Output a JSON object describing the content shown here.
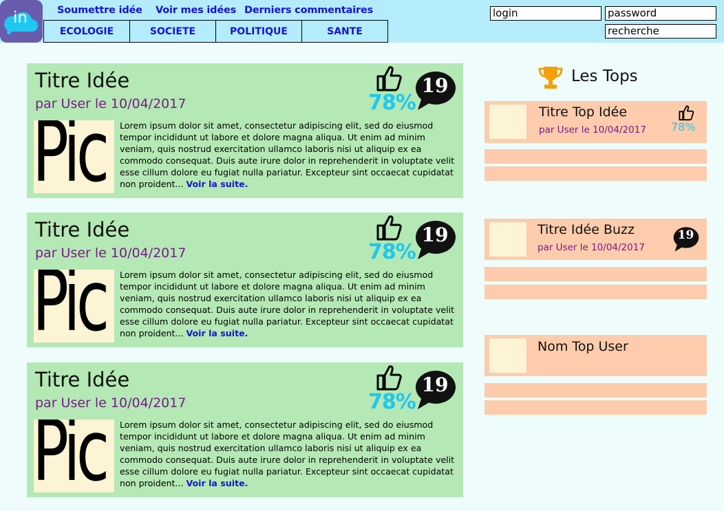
{
  "header": {
    "logo_text": "in",
    "nav": {
      "submit": "Soumettre idée",
      "my_ideas": "Voir mes idées",
      "latest_comments": "Derniers commentaires"
    },
    "categories": [
      "ECOLOGIE",
      "SOCIETE",
      "POLITIQUE",
      "SANTE"
    ],
    "login_placeholder": "login",
    "password_placeholder": "password",
    "search_placeholder": "recherche"
  },
  "ideas": [
    {
      "title": "Titre Idée",
      "author": "par User le 10/04/2017",
      "percent": "78%",
      "comments": "19",
      "pic": "Pic",
      "body": "Lorem ipsum dolor sit amet, consectetur adipiscing elit, sed do eiusmod tempor incididunt ut labore et dolore magna aliqua. Ut enim ad minim veniam, quis nostrud exercitation ullamco laboris nisi ut aliquip ex ea commodo consequat. Duis aute irure dolor in reprehenderit in voluptate velit esse cillum dolore eu fugiat nulla pariatur. Excepteur sint occaecat cupidatat non proident...",
      "more": "Voir la suite."
    },
    {
      "title": "Titre Idée",
      "author": "par User le 10/04/2017",
      "percent": "78%",
      "comments": "19",
      "pic": "Pic",
      "body": "Lorem ipsum dolor sit amet, consectetur adipiscing elit, sed do eiusmod tempor incididunt ut labore et dolore magna aliqua. Ut enim ad minim veniam, quis nostrud exercitation ullamco laboris nisi ut aliquip ex ea commodo consequat. Duis aute irure dolor in reprehenderit in voluptate velit esse cillum dolore eu fugiat nulla pariatur. Excepteur sint occaecat cupidatat non proident...",
      "more": "Voir la suite."
    },
    {
      "title": "Titre Idée",
      "author": "par User le 10/04/2017",
      "percent": "78%",
      "comments": "19",
      "pic": "Pic",
      "body": "Lorem ipsum dolor sit amet, consectetur adipiscing elit, sed do eiusmod tempor incididunt ut labore et dolore magna aliqua. Ut enim ad minim veniam, quis nostrud exercitation ullamco laboris nisi ut aliquip ex ea commodo consequat. Duis aute irure dolor in reprehenderit in voluptate velit esse cillum dolore eu fugiat nulla pariatur. Excepteur sint occaecat cupidatat non proident...",
      "more": "Voir la suite."
    }
  ],
  "sidebar": {
    "title": "Les Tops",
    "top_idea": {
      "title": "Titre Top Idée",
      "author": "par User le 10/04/2017",
      "percent": "78%"
    },
    "buzz_idea": {
      "title": "Titre Idée Buzz",
      "author": "par User le 10/04/2017",
      "comments": "19"
    },
    "top_user": {
      "name": "Nom Top User"
    }
  },
  "colors": {
    "header_bg": "#b4ecfc",
    "logo_bg": "#6a5cac",
    "link": "#1414d4",
    "card_bg": "#b4e8b4",
    "author": "#7a1a8a",
    "percent": "#1ec8f0",
    "side_bg": "#fcccac",
    "pic_bg": "#fcf4d4",
    "trophy": "#f4a00c"
  }
}
